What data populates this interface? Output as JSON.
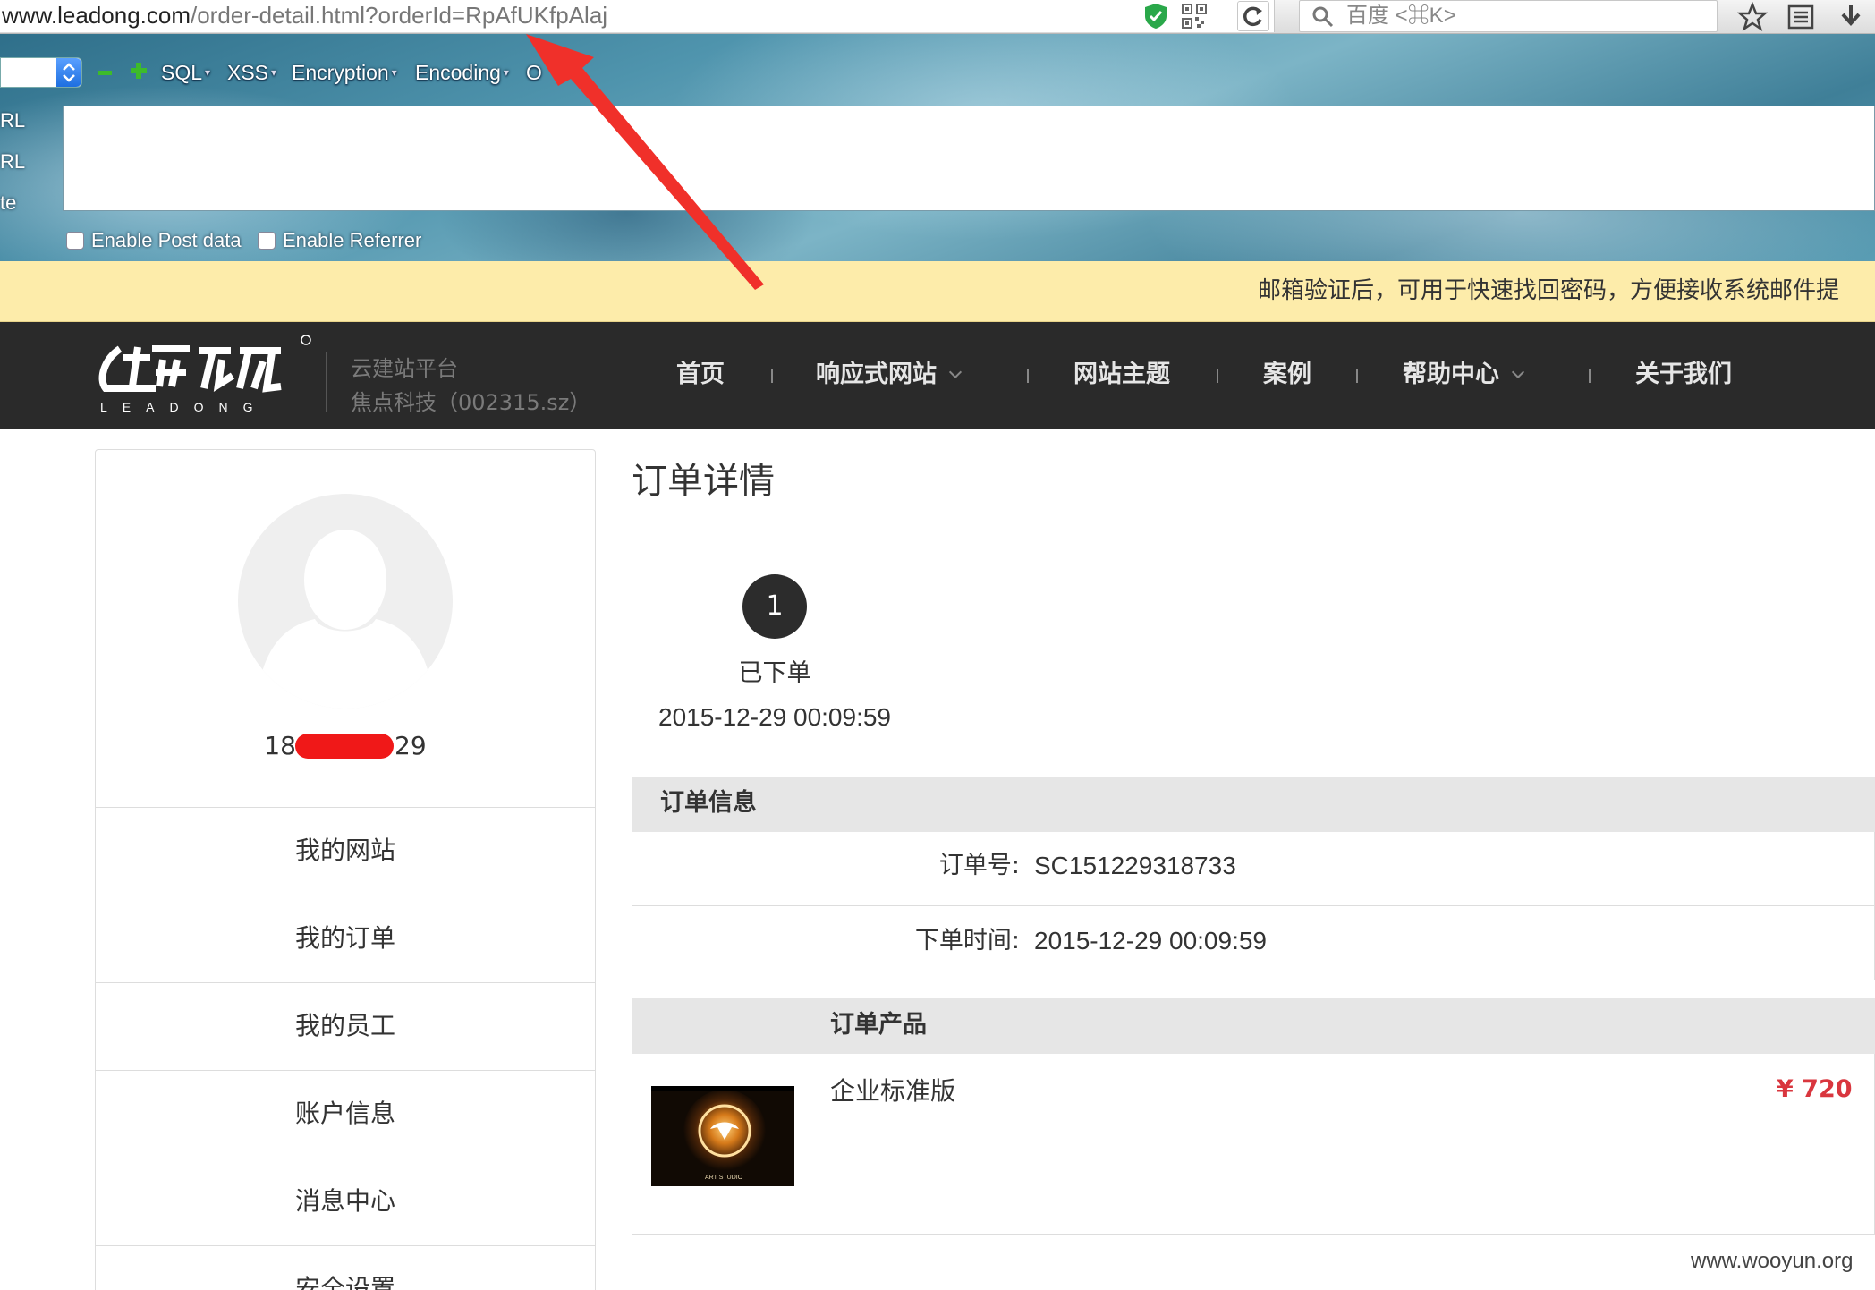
{
  "browser": {
    "url_domain": "www.leadong.com",
    "url_path": "/order-detail.html?orderId=RpAfUKfpAlaj",
    "search_placeholder": "百度 <⌘K>"
  },
  "hackbar": {
    "menu": [
      "SQL",
      "XSS",
      "Encryption",
      "Encoding",
      "O"
    ],
    "labels": [
      "RL",
      "RL",
      "te"
    ],
    "post_checkbox": "Enable Post data",
    "referrer_checkbox": "Enable Referrer"
  },
  "notice": "邮箱验证后，可用于快速找回密码，方便接收系统邮件提",
  "site": {
    "logo_word": "LEADONG",
    "logo_sub1": "云建站平台",
    "logo_sub2": "焦点科技（002315.sz）",
    "nav": [
      "首页",
      "响应式网站",
      "网站主题",
      "案例",
      "帮助中心",
      "关于我们"
    ]
  },
  "sidebar": {
    "user_prefix": "18",
    "user_suffix": "29",
    "items": [
      "我的网站",
      "我的订单",
      "我的员工",
      "账户信息",
      "消息中心",
      "安全设置"
    ]
  },
  "order": {
    "title": "订单详情",
    "step_number": "1",
    "step_label": "已下单",
    "step_time": "2015-12-29 00:09:59",
    "info_header": "订单信息",
    "order_no_label": "订单号:",
    "order_no": "SC151229318733",
    "order_time_label": "下单时间:",
    "order_time": "2015-12-29 00:09:59",
    "products_header": "订单产品",
    "product_name": "企业标准版",
    "product_price": "¥ 720",
    "thumb_caption": "ART STUDIO"
  },
  "watermark": "www.wooyun.org",
  "colors": {
    "nav_bg": "#2a2a2a",
    "notice_bg": "#fdecaa",
    "price": "#d9363e",
    "arrow": "#f0302a"
  }
}
